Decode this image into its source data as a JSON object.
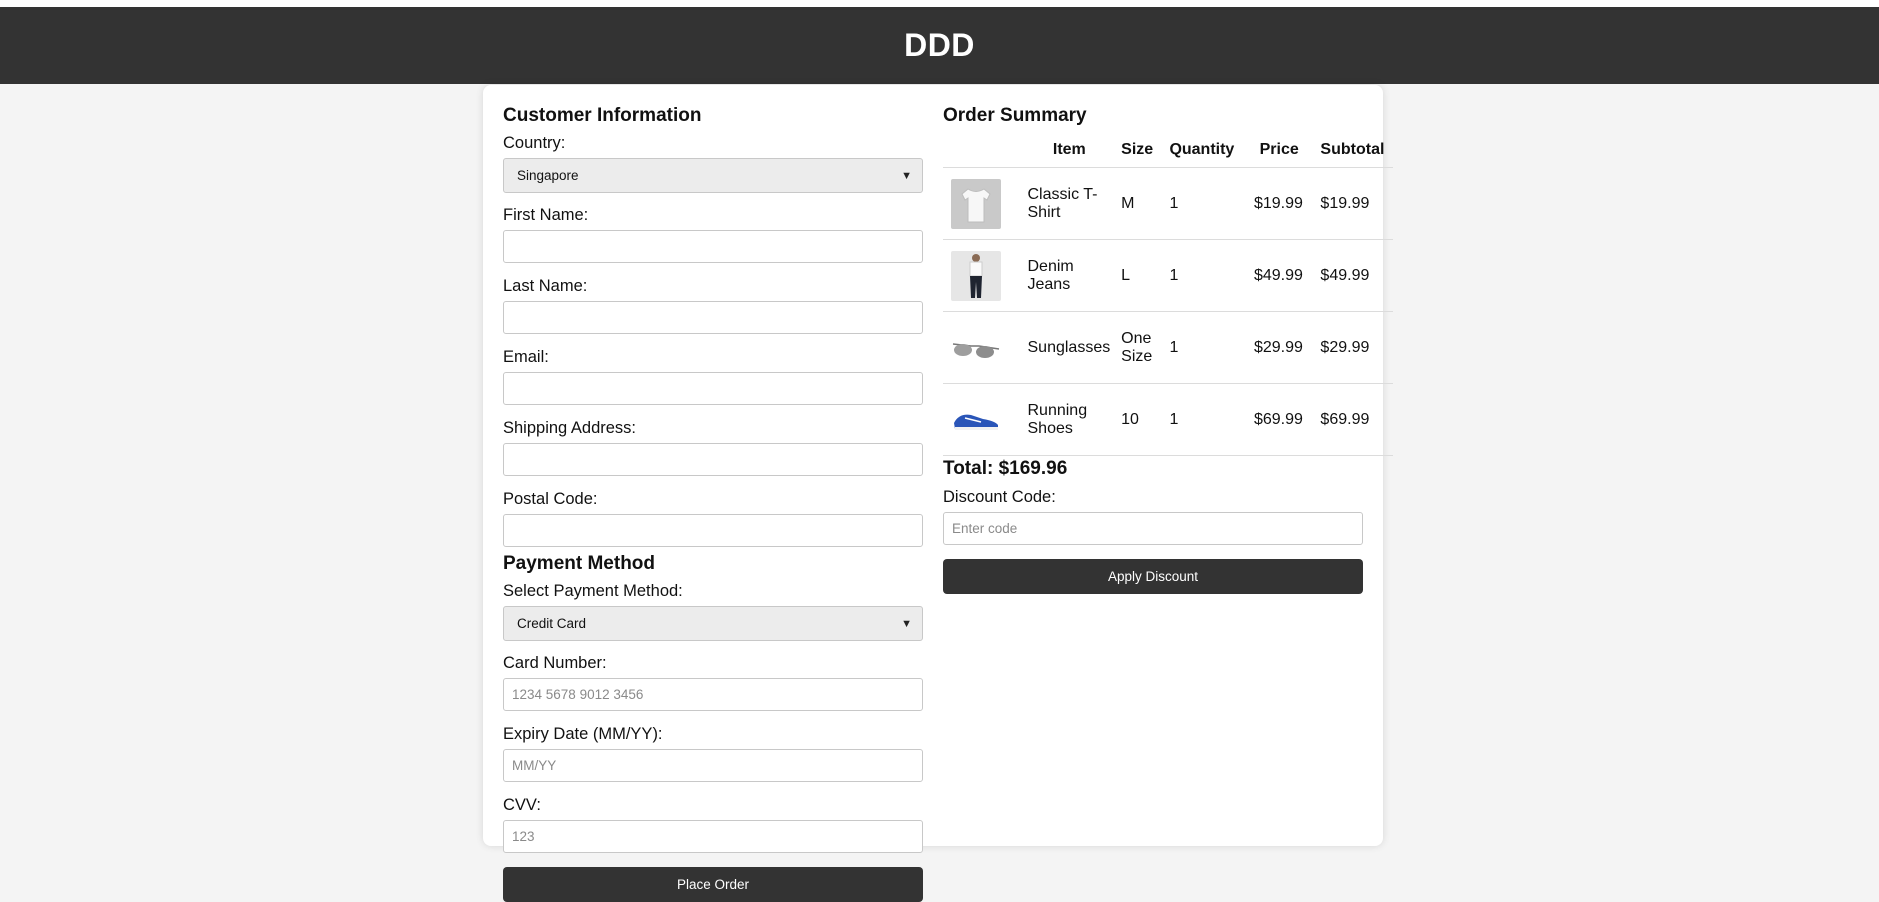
{
  "header": {
    "title": "DDD"
  },
  "customer": {
    "heading": "Customer Information",
    "country_label": "Country:",
    "country_value": "Singapore",
    "first_name_label": "First Name:",
    "first_name_value": "",
    "last_name_label": "Last Name:",
    "last_name_value": "",
    "email_label": "Email:",
    "email_value": "",
    "address_label": "Shipping Address:",
    "address_value": "",
    "postal_label": "Postal Code:",
    "postal_value": ""
  },
  "payment": {
    "heading": "Payment Method",
    "method_label": "Select Payment Method:",
    "method_value": "Credit Card",
    "card_label": "Card Number:",
    "card_placeholder": "1234 5678 9012 3456",
    "expiry_label": "Expiry Date (MM/YY):",
    "expiry_placeholder": "MM/YY",
    "cvv_label": "CVV:",
    "cvv_placeholder": "123",
    "place_order": "Place Order"
  },
  "order": {
    "heading": "Order Summary",
    "columns": [
      "",
      "Item",
      "Size",
      "Quantity",
      "Price",
      "Subtotal"
    ],
    "items": [
      {
        "image_icon": "tshirt-image",
        "name": "Classic T-Shirt",
        "size": "M",
        "quantity": "1",
        "price": "$19.99",
        "subtotal": "$19.99"
      },
      {
        "image_icon": "jeans-image",
        "name": "Denim Jeans",
        "size": "L",
        "quantity": "1",
        "price": "$49.99",
        "subtotal": "$49.99"
      },
      {
        "image_icon": "sunglasses-image",
        "name": "Sunglasses",
        "size": "One Size",
        "quantity": "1",
        "price": "$29.99",
        "subtotal": "$29.99"
      },
      {
        "image_icon": "shoes-image",
        "name": "Running Shoes",
        "size": "10",
        "quantity": "1",
        "price": "$69.99",
        "subtotal": "$69.99"
      }
    ],
    "total": "Total: $169.96",
    "discount_label": "Discount Code:",
    "discount_placeholder": "Enter code",
    "apply_button": "Apply Discount"
  },
  "colors": {
    "header_bg": "#333333",
    "button_bg": "#333333",
    "page_bg": "#f4f4f4"
  }
}
